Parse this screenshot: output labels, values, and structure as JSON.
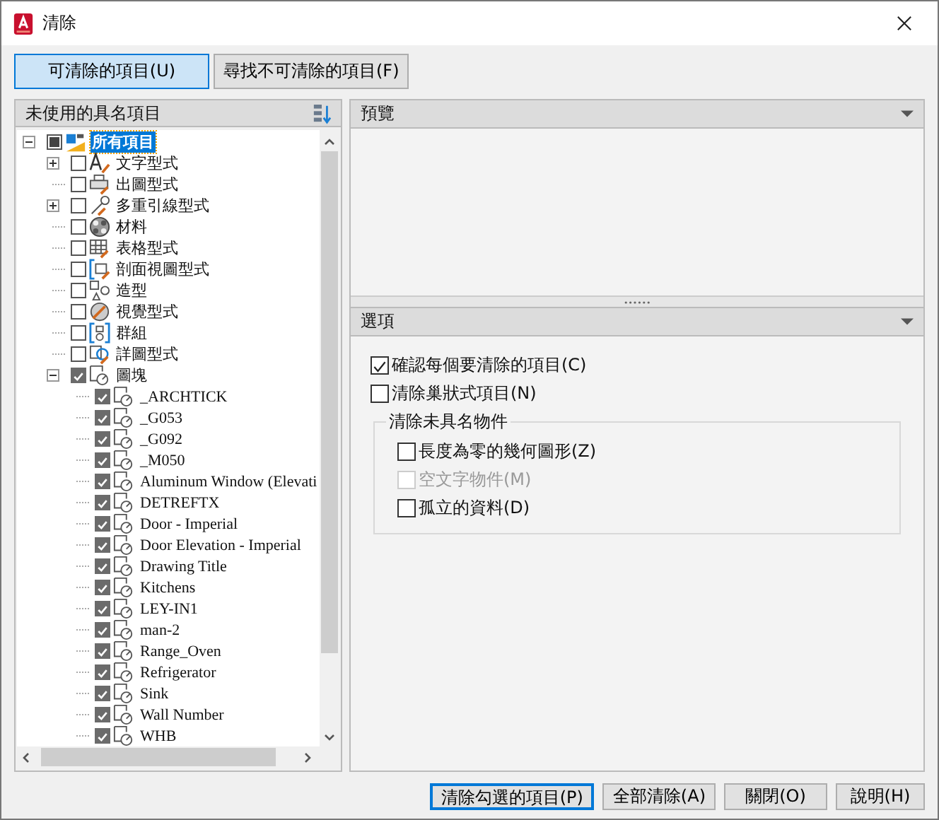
{
  "window": {
    "title": "清除"
  },
  "tabs": [
    {
      "label": "可清除的項目(U)",
      "selected": true
    },
    {
      "label": "尋找不可清除的項目(F)",
      "selected": false
    }
  ],
  "tree_panel": {
    "title": "未使用的具名項目"
  },
  "tree": {
    "label": "所有項目",
    "kind": "drawing",
    "checked": false,
    "partial": true,
    "expanded": true,
    "selected": true,
    "children": [
      {
        "label": "文字型式",
        "kind": "text-style",
        "checked": false,
        "expanded": false
      },
      {
        "label": "出圖型式",
        "kind": "plot-style",
        "checked": false
      },
      {
        "label": "多重引線型式",
        "kind": "mleader",
        "checked": false,
        "expanded": false
      },
      {
        "label": "材料",
        "kind": "material",
        "checked": false
      },
      {
        "label": "表格型式",
        "kind": "table",
        "checked": false
      },
      {
        "label": "剖面視圖型式",
        "kind": "section",
        "checked": false
      },
      {
        "label": "造型",
        "kind": "shape",
        "checked": false
      },
      {
        "label": "視覺型式",
        "kind": "visual",
        "checked": false
      },
      {
        "label": "群組",
        "kind": "group",
        "checked": false
      },
      {
        "label": "詳圖型式",
        "kind": "detail",
        "checked": false
      },
      {
        "label": "圖塊",
        "kind": "block",
        "checked": true,
        "expanded": true,
        "children": [
          {
            "label": "_ARCHTICK",
            "kind": "block",
            "checked": true
          },
          {
            "label": "_G053",
            "kind": "block",
            "checked": true
          },
          {
            "label": "_G092",
            "kind": "block",
            "checked": true
          },
          {
            "label": "_M050",
            "kind": "block",
            "checked": true
          },
          {
            "label": "Aluminum Window (Elevati",
            "kind": "block",
            "checked": true
          },
          {
            "label": "DETREFTX",
            "kind": "block",
            "checked": true
          },
          {
            "label": "Door - Imperial",
            "kind": "block",
            "checked": true
          },
          {
            "label": "Door Elevation - Imperial",
            "kind": "block",
            "checked": true
          },
          {
            "label": "Drawing Title",
            "kind": "block",
            "checked": true
          },
          {
            "label": "Kitchens",
            "kind": "block",
            "checked": true
          },
          {
            "label": "LEY-IN1",
            "kind": "block",
            "checked": true
          },
          {
            "label": "man-2",
            "kind": "block",
            "checked": true
          },
          {
            "label": "Range_Oven",
            "kind": "block",
            "checked": true
          },
          {
            "label": "Refrigerator",
            "kind": "block",
            "checked": true
          },
          {
            "label": "Sink",
            "kind": "block",
            "checked": true
          },
          {
            "label": "Wall Number",
            "kind": "block",
            "checked": true
          },
          {
            "label": "WHB",
            "kind": "block",
            "checked": true
          }
        ]
      }
    ]
  },
  "preview_panel": {
    "title": "預覽"
  },
  "options_panel": {
    "title": "選項",
    "options": [
      {
        "label": "確認每個要清除的項目(C)",
        "checked": true,
        "disabled": false
      },
      {
        "label": "清除巢狀式項目(N)",
        "checked": false,
        "disabled": false
      }
    ],
    "group": {
      "title": "清除未具名物件",
      "options": [
        {
          "label": "長度為零的幾何圖形(Z)",
          "checked": false,
          "disabled": false
        },
        {
          "label": "空文字物件(M)",
          "checked": false,
          "disabled": true
        },
        {
          "label": "孤立的資料(D)",
          "checked": false,
          "disabled": false
        }
      ]
    }
  },
  "buttons": [
    {
      "label": "清除勾選的項目(P)",
      "default": true
    },
    {
      "label": "全部清除(A)",
      "default": false
    },
    {
      "label": "關閉(O)",
      "default": false
    },
    {
      "label": "說明(H)",
      "default": false
    }
  ]
}
